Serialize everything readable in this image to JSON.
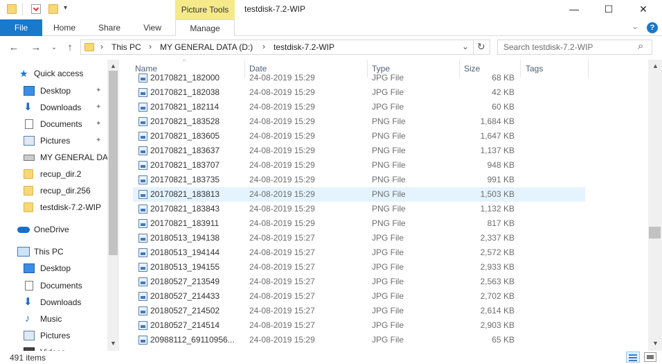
{
  "titlebar": {
    "picture_tools": "Picture Tools",
    "title": "testdisk-7.2-WIP",
    "minimize": "—",
    "maximize": "☐",
    "close": "✕"
  },
  "ribbon": {
    "tabs": [
      "File",
      "Home",
      "Share",
      "View",
      "Manage"
    ],
    "help": "?",
    "collapse": "⌄"
  },
  "address": {
    "back": "←",
    "forward": "→",
    "recent": "⌄",
    "up": "↑",
    "crumbs": [
      "This PC",
      "MY GENERAL DATA (D:)",
      "testdisk-7.2-WIP"
    ],
    "sep": "›",
    "dropdown": "⌄",
    "refresh": "↻",
    "search_placeholder": "Search testdisk-7.2-WIP",
    "search_icon": "⌕"
  },
  "nav": {
    "items": [
      {
        "label": "Quick access",
        "icon": "star-icon"
      },
      {
        "label": "Desktop",
        "icon": "desktop-icon",
        "pinned": true
      },
      {
        "label": "Downloads",
        "icon": "downloads-icon",
        "pinned": true
      },
      {
        "label": "Documents",
        "icon": "documents-icon",
        "pinned": true
      },
      {
        "label": "Pictures",
        "icon": "pictures-icon",
        "pinned": true
      },
      {
        "label": "MY GENERAL DATA (D:)",
        "icon": "drive-icon"
      },
      {
        "label": "recup_dir.2",
        "icon": "folder-icon"
      },
      {
        "label": "recup_dir.256",
        "icon": "folder-icon"
      },
      {
        "label": "testdisk-7.2-WIP",
        "icon": "folder-icon"
      },
      {
        "label": "OneDrive",
        "icon": "onedrive-icon"
      },
      {
        "label": "This PC",
        "icon": "this-pc-icon"
      },
      {
        "label": "Desktop",
        "icon": "desktop-icon"
      },
      {
        "label": "Documents",
        "icon": "documents-icon"
      },
      {
        "label": "Downloads",
        "icon": "downloads-icon"
      },
      {
        "label": "Music",
        "icon": "music-icon"
      },
      {
        "label": "Pictures",
        "icon": "pictures-icon"
      },
      {
        "label": "Videos",
        "icon": "videos-icon"
      }
    ],
    "pin_glyph": "📌"
  },
  "columns": {
    "name": "Name",
    "date": "Date",
    "type": "Type",
    "size": "Size",
    "tags": "Tags",
    "sort_arrow": "^"
  },
  "files": [
    {
      "name": "20170821_182000",
      "date": "24-08-2019 15:29",
      "type": "JPG File",
      "size": "68 KB"
    },
    {
      "name": "20170821_182038",
      "date": "24-08-2019 15:29",
      "type": "JPG File",
      "size": "42 KB"
    },
    {
      "name": "20170821_182114",
      "date": "24-08-2019 15:29",
      "type": "JPG File",
      "size": "60 KB"
    },
    {
      "name": "20170821_183528",
      "date": "24-08-2019 15:29",
      "type": "PNG File",
      "size": "1,684 KB"
    },
    {
      "name": "20170821_183605",
      "date": "24-08-2019 15:29",
      "type": "PNG File",
      "size": "1,647 KB"
    },
    {
      "name": "20170821_183637",
      "date": "24-08-2019 15:29",
      "type": "PNG File",
      "size": "1,137 KB"
    },
    {
      "name": "20170821_183707",
      "date": "24-08-2019 15:29",
      "type": "PNG File",
      "size": "948 KB"
    },
    {
      "name": "20170821_183735",
      "date": "24-08-2019 15:29",
      "type": "PNG File",
      "size": "991 KB"
    },
    {
      "name": "20170821_183813",
      "date": "24-08-2019 15:29",
      "type": "PNG File",
      "size": "1,503 KB"
    },
    {
      "name": "20170821_183843",
      "date": "24-08-2019 15:29",
      "type": "PNG File",
      "size": "1,132 KB"
    },
    {
      "name": "20170821_183911",
      "date": "24-08-2019 15:29",
      "type": "PNG File",
      "size": "817 KB"
    },
    {
      "name": "20180513_194138",
      "date": "24-08-2019 15:27",
      "type": "JPG File",
      "size": "2,337 KB"
    },
    {
      "name": "20180513_194144",
      "date": "24-08-2019 15:27",
      "type": "JPG File",
      "size": "2,572 KB"
    },
    {
      "name": "20180513_194155",
      "date": "24-08-2019 15:27",
      "type": "JPG File",
      "size": "2,933 KB"
    },
    {
      "name": "20180527_213549",
      "date": "24-08-2019 15:27",
      "type": "JPG File",
      "size": "2,563 KB"
    },
    {
      "name": "20180527_214433",
      "date": "24-08-2019 15:27",
      "type": "JPG File",
      "size": "2,702 KB"
    },
    {
      "name": "20180527_214502",
      "date": "24-08-2019 15:27",
      "type": "JPG File",
      "size": "2,614 KB"
    },
    {
      "name": "20180527_214514",
      "date": "24-08-2019 15:27",
      "type": "JPG File",
      "size": "2,903 KB"
    },
    {
      "name": "20988112_69110956...",
      "date": "24-08-2019 15:29",
      "type": "JPG File",
      "size": "65 KB"
    }
  ],
  "selected_file": "20170821_183813",
  "status": {
    "count": "491 items"
  },
  "scroll": {
    "up": "▲",
    "down": "▼"
  },
  "colors": {
    "accent": "#1979ca",
    "picture_tools": "#f5e98a",
    "selection": "#e5f3ff",
    "header_text": "#4c607a"
  }
}
